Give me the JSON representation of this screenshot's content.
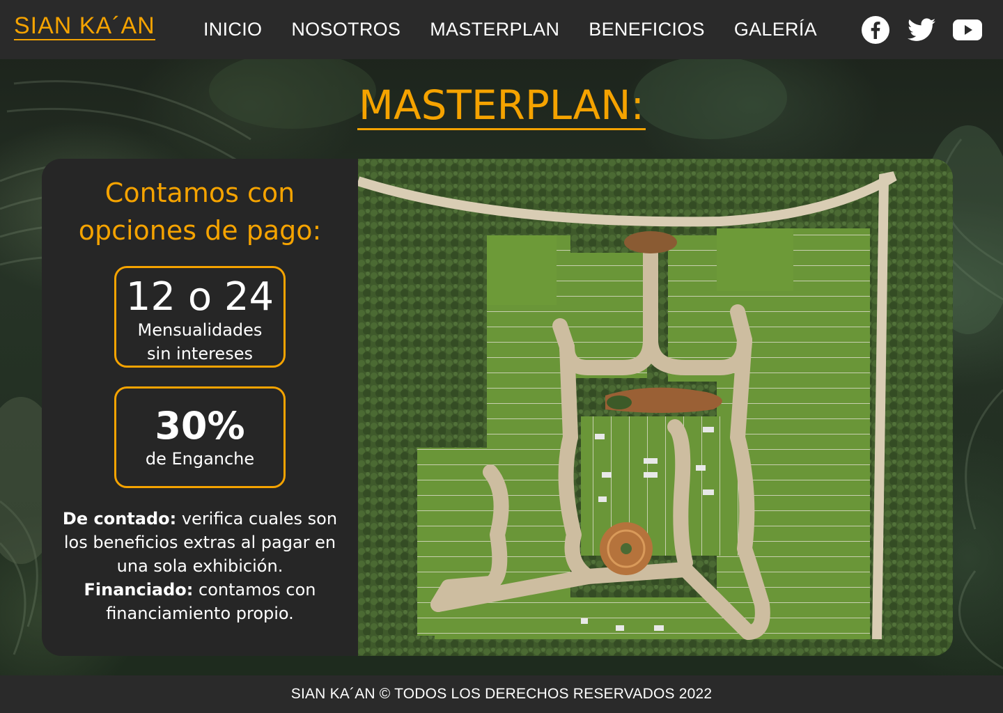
{
  "brand": {
    "logo": "SIAN KA´AN",
    "accent_color": "#f5a300"
  },
  "nav": {
    "items": [
      "INICIO",
      "NOSOTROS",
      "MASTERPLAN",
      "BENEFICIOS",
      "GALERÍA"
    ]
  },
  "social": {
    "icons": [
      "facebook-icon",
      "twitter-icon",
      "youtube-icon"
    ]
  },
  "section": {
    "title": "MASTERPLAN:"
  },
  "payment": {
    "heading_line1": "Contamos con",
    "heading_line2": "opciones de pago:",
    "installments": {
      "value": "12 o 24",
      "label_line1": "Mensualidades",
      "label_line2": "sin intereses"
    },
    "down_payment": {
      "value": "30%",
      "label": "de Enganche"
    },
    "cash_label": "De contado:",
    "cash_text": " verifica cuales son los beneficios extras al pagar en una sola exhibición.",
    "financed_label": "Financiado:",
    "financed_text": " contamos con financiamiento propio."
  },
  "footer": {
    "text": "SIAN KA´AN © TODOS LOS DERECHOS RESERVADOS 2022"
  }
}
